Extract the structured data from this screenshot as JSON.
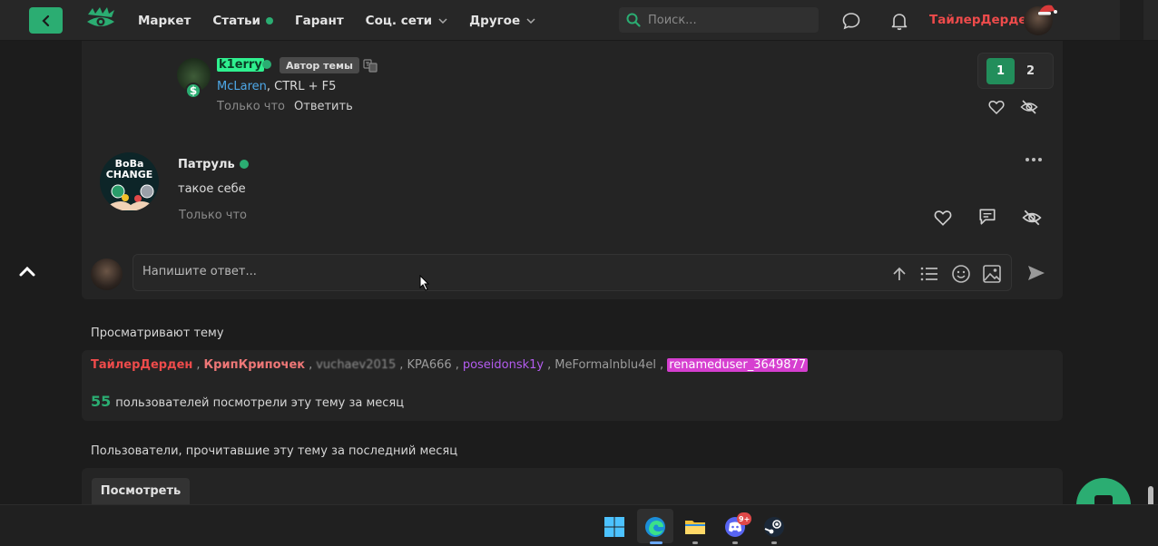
{
  "header": {
    "nav": [
      {
        "label": "Маркет"
      },
      {
        "label": "Статьи"
      },
      {
        "label": "Гарант"
      },
      {
        "label": "Соц. сети"
      },
      {
        "label": "Другое"
      }
    ],
    "search_placeholder": "Поиск...",
    "username": "ТайлерДерден"
  },
  "reply": {
    "author": "k1erry",
    "author_badge": "Автор темы",
    "mention": "McLaren",
    "text": ", CTRL + F5",
    "time": "Только что",
    "answer_label": "Ответить"
  },
  "pagination": {
    "pages": [
      "1",
      "2"
    ],
    "current": "1"
  },
  "post": {
    "avatar_text_1": "BoBa",
    "avatar_text_2": "CHANGE",
    "author": "Патруль",
    "body": "такое себе",
    "time": "Только что"
  },
  "editor": {
    "placeholder": "Напишите ответ..."
  },
  "viewers": {
    "title": "Просматривают тему",
    "users": [
      {
        "name": "ТайлерДерден",
        "style": "red"
      },
      {
        "name": "КрипКрипочек",
        "style": "pink"
      },
      {
        "name": "vuchaev2015",
        "style": "blur"
      },
      {
        "name": "KPA666",
        "style": "gray"
      },
      {
        "name": "poseidonsk1y",
        "style": "purple"
      },
      {
        "name": "MeFormalnblu4el",
        "style": "gray"
      },
      {
        "name": "renameduser_3649877",
        "style": "mag"
      }
    ],
    "separator": ",",
    "count": "55",
    "count_text": "пользователей посмотрели эту тему за месяц"
  },
  "readers": {
    "title": "Пользователи, прочитавшие эту тему за последний месяц",
    "button": "Посмотреть"
  },
  "taskbar": {
    "discord_badge": "9+"
  },
  "colors": {
    "accent": "#2bad72",
    "username": "#ee4b4b",
    "link": "#4ea8e8"
  }
}
